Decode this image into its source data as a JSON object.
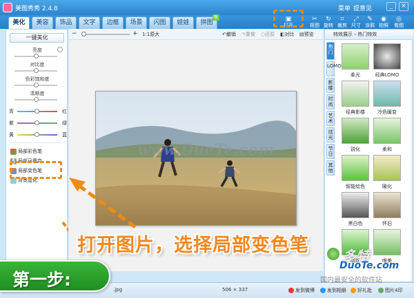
{
  "app": {
    "title": "美图秀秀 2.4.8"
  },
  "titlebar": {
    "menu": "菜单",
    "feedback": "提意见",
    "min": "_",
    "close": "×"
  },
  "tabs": [
    {
      "label": "美化",
      "active": true
    },
    {
      "label": "美容"
    },
    {
      "label": "饰品"
    },
    {
      "label": "文字"
    },
    {
      "label": "边框"
    },
    {
      "label": "场景"
    },
    {
      "label": "闪图"
    },
    {
      "label": "娃娃"
    },
    {
      "label": "拼图",
      "badge": "新"
    }
  ],
  "tools": [
    {
      "label": "打开",
      "icon": "open-folder-icon",
      "glyph": "▣"
    },
    {
      "label": "抠图",
      "icon": "cutout-icon",
      "glyph": "✂"
    },
    {
      "label": "旋转",
      "icon": "rotate-icon",
      "glyph": "↻"
    },
    {
      "label": "裁剪",
      "icon": "crop-icon",
      "glyph": "⌗"
    },
    {
      "label": "尺寸",
      "icon": "resize-icon",
      "glyph": "⤢"
    },
    {
      "label": "涂鸦",
      "icon": "brush-icon",
      "glyph": "✎"
    },
    {
      "label": "拍照",
      "icon": "camera-icon",
      "glyph": "◉"
    },
    {
      "label": "看图",
      "icon": "viewer-icon",
      "glyph": "◎"
    }
  ],
  "left_panel": {
    "auto_button": "一键美化",
    "sliders": [
      {
        "label": "亮度",
        "value": 0.5
      },
      {
        "label": "对比度",
        "value": 0.5
      },
      {
        "label": "色彩饱和度",
        "value": 0.5
      },
      {
        "label": "清晰度",
        "value": 0.5
      }
    ],
    "color_balance": [
      {
        "left": "青",
        "right": "红",
        "value": 0.5
      },
      {
        "left": "紫",
        "right": "绿",
        "value": 0.5
      },
      {
        "left": "黄",
        "right": "蓝",
        "value": 0.5
      }
    ],
    "local_tools": [
      {
        "label": "局部彩色笔"
      },
      {
        "label": "局部马赛克"
      },
      {
        "label": "局部变色笔"
      },
      {
        "label": "背景虚化"
      }
    ]
  },
  "canvas_bar": {
    "zoom_minus": "−",
    "zoom_plus": "+",
    "zoom_label": "1:1原大",
    "undo": "撤销",
    "redo": "重做",
    "reset": "还原",
    "compare": "对比",
    "preview": "预览"
  },
  "watermark_text": "www.DueTe.com",
  "right_panel": {
    "header": "特效展示 › 热门特效",
    "vtabs": [
      {
        "label": "热门",
        "active": true
      },
      {
        "label": "LOMO"
      },
      {
        "label": "影楼"
      },
      {
        "label": "时尚"
      },
      {
        "label": "艺术"
      },
      {
        "label": "炫光"
      },
      {
        "label": "节日"
      },
      {
        "label": "其他"
      }
    ],
    "effects": [
      {
        "label": "柔光"
      },
      {
        "label": "经典LOMO"
      },
      {
        "label": "经典影楼"
      },
      {
        "label": "冷色暖变"
      },
      {
        "label": "锐化"
      },
      {
        "label": "柔和"
      },
      {
        "label": "智能绘色"
      },
      {
        "label": "暖化"
      },
      {
        "label": "黑白色"
      },
      {
        "label": "怀旧"
      },
      {
        "label": "缤纷"
      },
      {
        "label": "唯美"
      }
    ]
  },
  "status": {
    "filename": ".jpg",
    "dimensions": "506 × 337",
    "weibo": "发到微博",
    "album": "发到相册",
    "friends": "好礼批",
    "batch": "图片4印"
  },
  "overlay": {
    "instruction": "打开图片，选择局部变色笔",
    "step": "第一步:",
    "site_logo": "多特",
    "site_domain": "DuoTe.com",
    "site_cn": "国内最安全的软件站"
  },
  "colors": {
    "accent_orange": "#f08a10",
    "titlebar_blue": "#2c84cc",
    "step_green": "#2aa02c",
    "balance_cyan_red": [
      "#3bc8d8",
      "#e54a4a"
    ],
    "balance_purple_green": [
      "#a85cd8",
      "#4ac84a"
    ],
    "balance_yellow_blue": [
      "#e8d640",
      "#4a6ae8"
    ]
  }
}
